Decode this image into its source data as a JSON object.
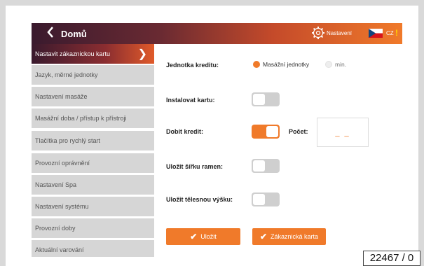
{
  "header": {
    "back_icon": "chevron-left-icon",
    "title": "Domů",
    "settings_icon": "gear-icon",
    "settings_label": "Nastavení",
    "language": "CZ",
    "warning_icon": "exclamation-icon",
    "gradient_colors": [
      "#3a1a2e",
      "#f07a2a"
    ]
  },
  "sidebar": {
    "items": [
      {
        "label": "Nastavit zákaznickou kartu",
        "active": true
      },
      {
        "label": "Jazyk, měrné jednotky"
      },
      {
        "label": "Nastavení masáže"
      },
      {
        "label": "Masážní doba / přístup k přístroji"
      },
      {
        "label": "Tlačítka pro rychlý start"
      },
      {
        "label": "Provozní oprávnění"
      },
      {
        "label": "Nastavení Spa"
      },
      {
        "label": "Nastavení systému"
      },
      {
        "label": "Provozní doby"
      },
      {
        "label": "Aktuální varování"
      }
    ]
  },
  "form": {
    "credit_unit": {
      "label": "Jednotka kreditu:",
      "options": [
        {
          "label": "Masážní jednotky",
          "selected": true
        },
        {
          "label": "min.",
          "selected": false
        }
      ]
    },
    "install_card": {
      "label": "Instalovat kartu:",
      "on": false
    },
    "top_up": {
      "label": "Dobít kredit:",
      "on": true,
      "count_label": "Počet:",
      "count_value": "_ _"
    },
    "save_shoulder": {
      "label": "Uložit šířku ramen:",
      "on": false
    },
    "save_height": {
      "label": "Uložit tělesnou výšku:",
      "on": false
    }
  },
  "buttons": {
    "save": "Uložit",
    "customer_card": "Zákaznická karta",
    "check_icon": "check-icon"
  },
  "accent_color": "#f07a2a",
  "stamp": "22467 / 0"
}
